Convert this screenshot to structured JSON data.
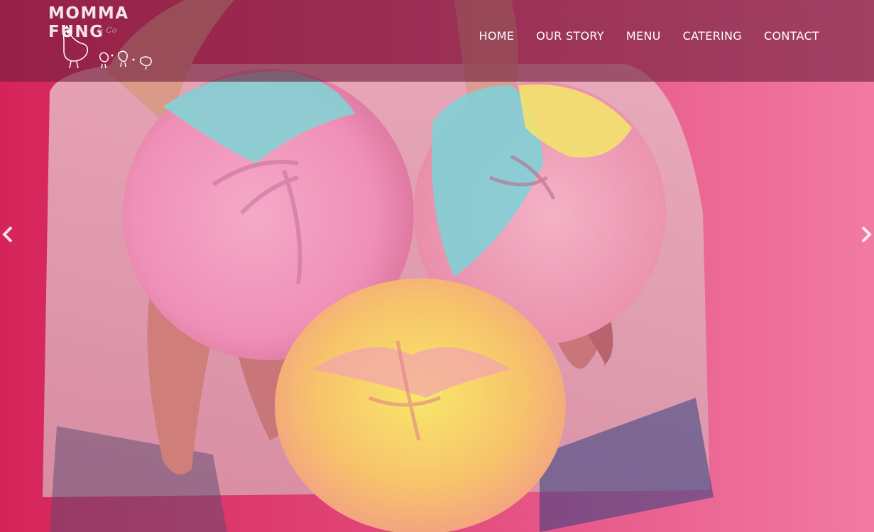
{
  "brand": {
    "name": "MOMMA FUNG",
    "sub": "& Co"
  },
  "nav": {
    "items": [
      {
        "label": "HOME"
      },
      {
        "label": "OUR STORY"
      },
      {
        "label": "MENU"
      },
      {
        "label": "CATERING"
      },
      {
        "label": "CONTACT"
      }
    ]
  },
  "slider": {
    "prev_icon": "chevron-left-icon",
    "next_icon": "chevron-right-icon"
  },
  "colors": {
    "header_overlay": "#701e3c",
    "background": "#e9497a",
    "text": "#ffffff"
  }
}
